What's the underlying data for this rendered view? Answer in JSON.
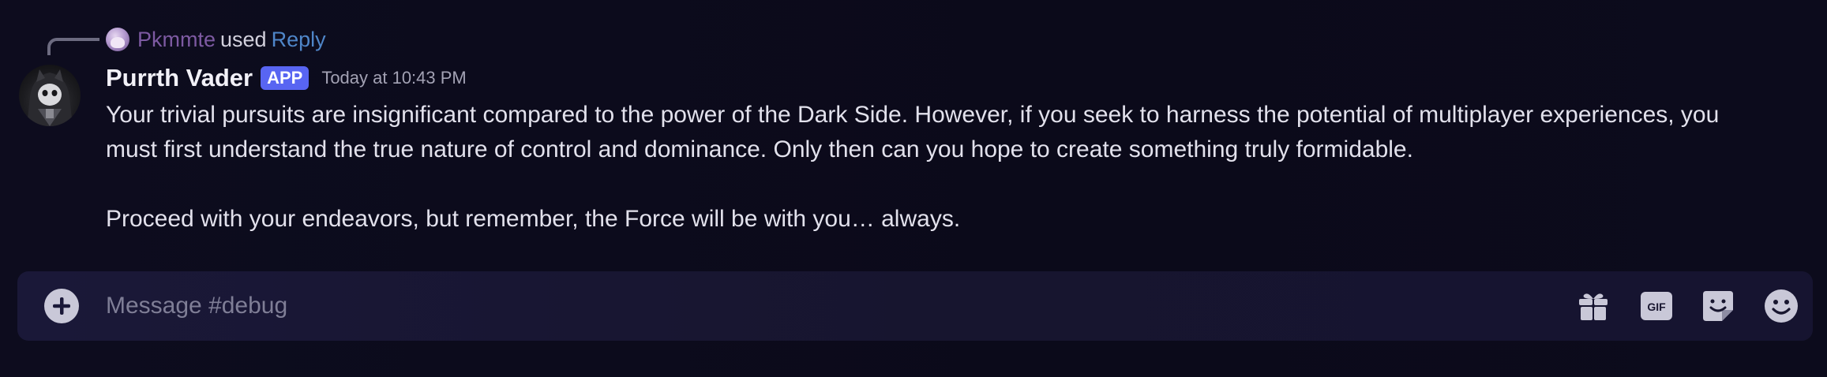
{
  "reply": {
    "user": "Pkmmte",
    "used": "used",
    "command": "Reply",
    "avatar_icon": "user-avatar"
  },
  "message": {
    "author": "Purrth Vader",
    "badge": "APP",
    "timestamp": "Today at 10:43 PM",
    "avatar_icon": "hooded-cat-avatar",
    "paragraphs": [
      "Your trivial pursuits are insignificant compared to the power of the Dark Side. However, if you seek to harness the potential of multiplayer experiences, you must first understand the true nature of control and dominance. Only then can you hope to create something truly formidable.",
      "Proceed with your endeavors, but remember, the Force will be with you… always."
    ]
  },
  "composer": {
    "placeholder": "Message #debug",
    "value": "",
    "tools": [
      "plus-circle-icon",
      "gift-icon",
      "gif-icon",
      "sticker-icon",
      "emoji-icon"
    ]
  },
  "colors": {
    "background": "#0c0b1c",
    "composer_bg": "#18162f",
    "reply_user": "#7d5aa2",
    "reply_command": "#4f86c9",
    "badge": "#5865f2",
    "icon": "#c9c8d8"
  }
}
